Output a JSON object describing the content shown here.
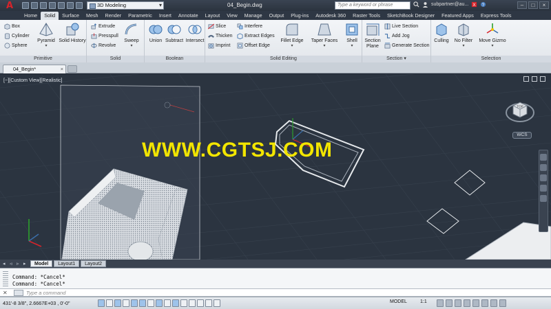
{
  "title_bar": {
    "workspace": "3D Modeling",
    "doc_title": "04_Begin.dwg",
    "search_placeholder": "Type a keyword or phrase",
    "user": "subpartner@au..."
  },
  "ribbon_tabs": [
    {
      "label": "Home"
    },
    {
      "label": "Solid"
    },
    {
      "label": "Surface"
    },
    {
      "label": "Mesh"
    },
    {
      "label": "Render"
    },
    {
      "label": "Parametric"
    },
    {
      "label": "Insert"
    },
    {
      "label": "Annotate"
    },
    {
      "label": "Layout"
    },
    {
      "label": "View"
    },
    {
      "label": "Manage"
    },
    {
      "label": "Output"
    },
    {
      "label": "Plug-ins"
    },
    {
      "label": "Autodesk 360"
    },
    {
      "label": "Raster Tools"
    },
    {
      "label": "SketchBook Designer"
    },
    {
      "label": "Featured Apps"
    },
    {
      "label": "Express Tools"
    }
  ],
  "ribbon": {
    "primitive": {
      "title": "Primitive",
      "box": "Box",
      "cylinder": "Cylinder",
      "sphere": "Sphere",
      "pyramid": "Pyramid",
      "solid_history": "Solid History"
    },
    "solid": {
      "title": "Solid",
      "extrude": "Extrude",
      "presspull": "Presspull",
      "revolve": "Revolve",
      "sweep": "Sweep"
    },
    "boolean": {
      "title": "Boolean",
      "union": "Union",
      "subtract": "Subtract",
      "intersect": "Intersect"
    },
    "solid_editing": {
      "title": "Solid Editing",
      "slice": "Slice",
      "thicken": "Thicken",
      "imprint": "Imprint",
      "interfere": "Interfere",
      "extract_edges": "Extract Edges",
      "offset_edge": "Offset Edge",
      "fillet_edge": "Fillet Edge",
      "taper_faces": "Taper Faces",
      "shell": "Shell"
    },
    "section": {
      "title": "Section",
      "section_plane": "Section Plane",
      "live_section": "Live Section",
      "add_jog": "Add Jog",
      "generate_section": "Generate Section"
    },
    "selection": {
      "title": "Selection",
      "culling": "Culling",
      "no_filter": "No Filter",
      "move_gizmo": "Move Gizmo"
    }
  },
  "doc_tab": {
    "label": "04_Begin*"
  },
  "viewport": {
    "label": "[−][Custom View][Realistic]",
    "wcs": "WCS",
    "viewcube_face": "TOP",
    "watermark": "WWW.CGTSJ.COM"
  },
  "layout_tabs": [
    {
      "label": "Model"
    },
    {
      "label": "Layout1"
    },
    {
      "label": "Layout2"
    }
  ],
  "command": {
    "history": [
      "Command: *Cancel*",
      "Command: *Cancel*"
    ],
    "placeholder": "Type a command"
  },
  "status_bar": {
    "coords": "431'-8 3/8\",  2.6667E+03  , 0'-0\"",
    "model": "MODEL",
    "scale": "1:1"
  },
  "colors": {
    "accent": "#3b7fd1",
    "viewport_bg": "#2b3440",
    "watermark": "#f2e500"
  }
}
